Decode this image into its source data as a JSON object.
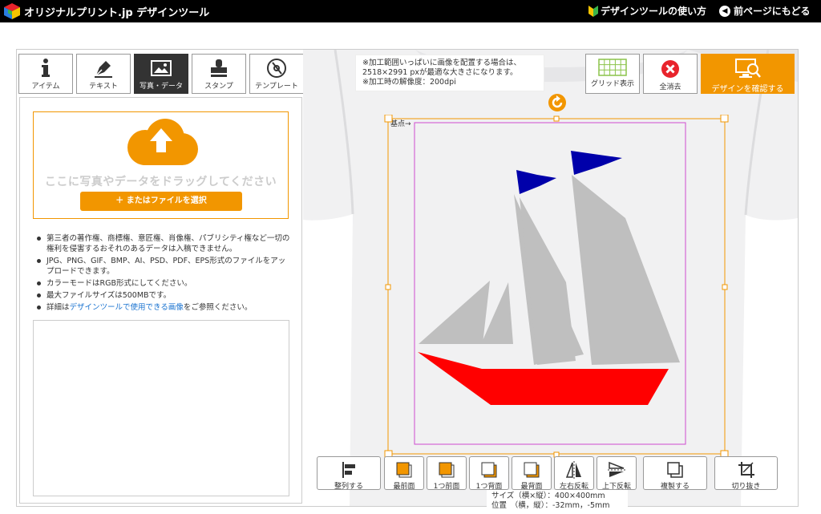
{
  "header": {
    "brand": "オリジナルプリント.jp デザインツール",
    "howto_label": "デザインツールの使い方",
    "back_label": "前ページにもどる"
  },
  "tabs": [
    {
      "label": "アイテム",
      "icon": "info-icon",
      "active": false
    },
    {
      "label": "テキスト",
      "icon": "pen-icon",
      "active": false
    },
    {
      "label": "写真・データ",
      "icon": "image-icon",
      "active": true
    },
    {
      "label": "スタンプ",
      "icon": "stamp-icon",
      "active": false
    },
    {
      "label": "テンプレート",
      "icon": "template-icon",
      "active": false
    }
  ],
  "upload": {
    "drop_text": "ここに写真やデータをドラッグしてください",
    "file_button": "またはファイルを選択",
    "notes": [
      "第三者の著作権、商標権、意匠権、肖像権、パブリシティ権など一切の権利を侵害するおそれのあるデータは入稿できません。",
      "JPG、PNG、GIF、BMP、AI、PSD、PDF、EPS形式のファイルをアップロードできます。",
      "カラーモードはRGB形式にしてください。",
      "最大ファイルサイズは500MBです。"
    ],
    "detail_prefix": "詳細は",
    "detail_link": "デザインツールで使用できる画像",
    "detail_suffix": "をご参照ください。"
  },
  "canvas_note": {
    "line1": "※加工範囲いっぱいに画像を配置する場合は、",
    "line2": "2518×2991 pxが最適な大きさになります。",
    "line3": "※加工時の解像度：200dpi"
  },
  "toolbar": {
    "grid_label": "グリッド表示",
    "clear_label": "全消去",
    "confirm_label": "デザインを確認する"
  },
  "origin_label": "基点→",
  "bottom_buttons": [
    {
      "label": "整列する",
      "icon": "align-icon"
    },
    {
      "label": "最前面",
      "icon": "bring-front-icon"
    },
    {
      "label": "1つ前面",
      "icon": "bring-forward-icon"
    },
    {
      "label": "1つ背面",
      "icon": "send-backward-icon"
    },
    {
      "label": "最背面",
      "icon": "send-back-icon"
    },
    {
      "label": "左右反転",
      "icon": "flip-horizontal-icon"
    },
    {
      "label": "上下反転",
      "icon": "flip-vertical-icon"
    },
    {
      "label": "複製する",
      "icon": "duplicate-icon"
    },
    {
      "label": "切り抜き",
      "icon": "crop-icon"
    }
  ],
  "size_info": {
    "size_line": "サイズ（横×縦）：400×400mm",
    "position_line": "位置　（横，縦）：-32mm，-5mm"
  },
  "colors": {
    "accent": "#f29600",
    "sail": "#bfbfbf",
    "hull": "#ff0000",
    "flag": "#0000aa"
  }
}
